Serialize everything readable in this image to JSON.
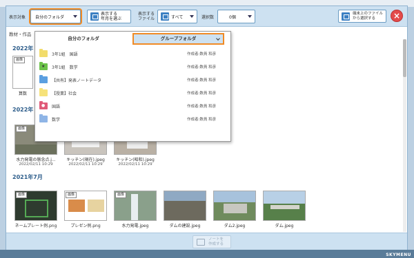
{
  "toolbar": {
    "display_target_label": "表示対象",
    "target_select": "自分のフォルダ",
    "year_button": "表示する\n年月を選ぶ",
    "file_label": "表示する\nファイル",
    "file_select": "すべて",
    "selected_label": "選択数",
    "selected_value": "0個",
    "device_button": "端末上のファイル\nから選択する",
    "close_label": "×"
  },
  "breadcrumb": "教材・作品",
  "dropdown": {
    "tab_mine": "自分のフォルダ",
    "tab_group": "グループフォルダ",
    "folders": [
      {
        "name": "3年1組　国語",
        "author": "作成者:数員 和彦",
        "color": "#f2dc6b",
        "symbol": ""
      },
      {
        "name": "3年1組　数学",
        "author": "作成者:数員 和彦",
        "color": "#6cc24a",
        "symbol": "★"
      },
      {
        "name": "【共有】発表ノートデータ",
        "author": "作成者:数員 和彦",
        "color": "#5b9fe0",
        "symbol": ""
      },
      {
        "name": "【授業】社会",
        "author": "作成者:数員 和彦",
        "color": "#f6e27a",
        "symbol": ""
      },
      {
        "name": "国語",
        "author": "作成者:数員 和彦",
        "color": "#e05b78",
        "symbol": "●"
      },
      {
        "name": "数学",
        "author": "作成者:数員 和彦",
        "color": "#8fb5e6",
        "symbol": ""
      }
    ]
  },
  "sections": {
    "y2022a": "2022年",
    "y2022b": "2022年",
    "y2021": "2021年7月"
  },
  "badge": "画像",
  "row1": [
    {
      "name": "算数",
      "date": ""
    }
  ],
  "row2": [
    {
      "name": "水力発電の懸念点.j...",
      "date": "2022/02/11 10:29"
    },
    {
      "name": "キッチン(現在).jpeg",
      "date": "2022/02/11 10:29"
    },
    {
      "name": "キッチン(昭和).jpeg",
      "date": "2022/02/11 10:29"
    }
  ],
  "row3": [
    {
      "name": "ネームプレート例.png"
    },
    {
      "name": "プレゼン例.png"
    },
    {
      "name": "水力発電.jpeg"
    },
    {
      "name": "ダムの建設.jpeg"
    },
    {
      "name": "ダム2.jpeg"
    },
    {
      "name": "ダム.jpeg"
    }
  ],
  "footer": {
    "note_button": "ノートを\n作成する"
  },
  "brand": "SKYMENU",
  "colors": {
    "accent": "#f08a24",
    "toolbar": "#cde1f1",
    "close": "#e34b4b"
  }
}
